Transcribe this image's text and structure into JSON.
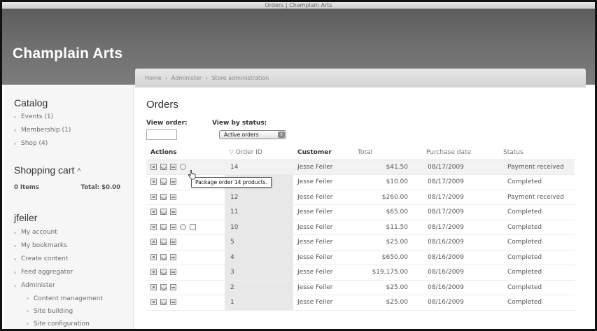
{
  "window": {
    "title": "Orders | Champlain Arts"
  },
  "site": {
    "name": "Champlain Arts"
  },
  "breadcrumb": [
    "Home",
    "›",
    "Administer",
    "›",
    "Store administration"
  ],
  "sidebar": {
    "catalog": {
      "title": "Catalog",
      "items": [
        "Events (1)",
        "Membership (1)",
        "Shop (4)"
      ]
    },
    "cart": {
      "title": "Shopping cart",
      "toggle": "^",
      "items_label": "0 Items",
      "total_label": "Total: $0.00"
    },
    "user": {
      "title": "jfeiler",
      "items": [
        "My account",
        "My bookmarks",
        "Create content",
        "Feed aggregator",
        "Administer"
      ],
      "sub_items": [
        "Content management",
        "Site building",
        "Site configuration"
      ]
    }
  },
  "main": {
    "title": "Orders",
    "view_order_label": "View order:",
    "view_order_value": "",
    "view_by_status_label": "View by status:",
    "status_selected": "Active orders"
  },
  "table": {
    "columns": [
      "Actions",
      "Order ID",
      "Customer",
      "Total",
      "Purchase date",
      "Status"
    ],
    "sort_indicator": "▽",
    "rows": [
      {
        "id": "14",
        "customer": "Jesse Feiler",
        "total": "$41.50",
        "date": "08/17/2009",
        "status": "Payment received"
      },
      {
        "id": "13",
        "customer": "Jesse Feiler",
        "total": "$10.00",
        "date": "08/17/2009",
        "status": "Completed"
      },
      {
        "id": "12",
        "customer": "Jesse Feiler",
        "total": "$260.00",
        "date": "08/17/2009",
        "status": "Payment received"
      },
      {
        "id": "11",
        "customer": "Jesse Feiler",
        "total": "$65.00",
        "date": "08/17/2009",
        "status": "Completed"
      },
      {
        "id": "10",
        "customer": "Jesse Feiler",
        "total": "$11.50",
        "date": "08/17/2009",
        "status": "Completed"
      },
      {
        "id": "5",
        "customer": "Jesse Feiler",
        "total": "$25.00",
        "date": "08/16/2009",
        "status": "Completed"
      },
      {
        "id": "4",
        "customer": "Jesse Feiler",
        "total": "$650.00",
        "date": "08/16/2009",
        "status": "Completed"
      },
      {
        "id": "3",
        "customer": "Jesse Feiler",
        "total": "$19,175.00",
        "date": "08/16/2009",
        "status": "Completed"
      },
      {
        "id": "2",
        "customer": "Jesse Feiler",
        "total": "$25.00",
        "date": "08/16/2009",
        "status": "Completed"
      },
      {
        "id": "1",
        "customer": "Jesse Feiler",
        "total": "$25.00",
        "date": "08/16/2009",
        "status": "Completed"
      }
    ]
  },
  "tooltip": {
    "text": "Package order 14 products."
  },
  "icons": {
    "action_icons": [
      "view-icon",
      "edit-icon",
      "print-icon",
      "package-icon",
      "ship-icon"
    ],
    "cursor": "hand-pointer-icon"
  }
}
